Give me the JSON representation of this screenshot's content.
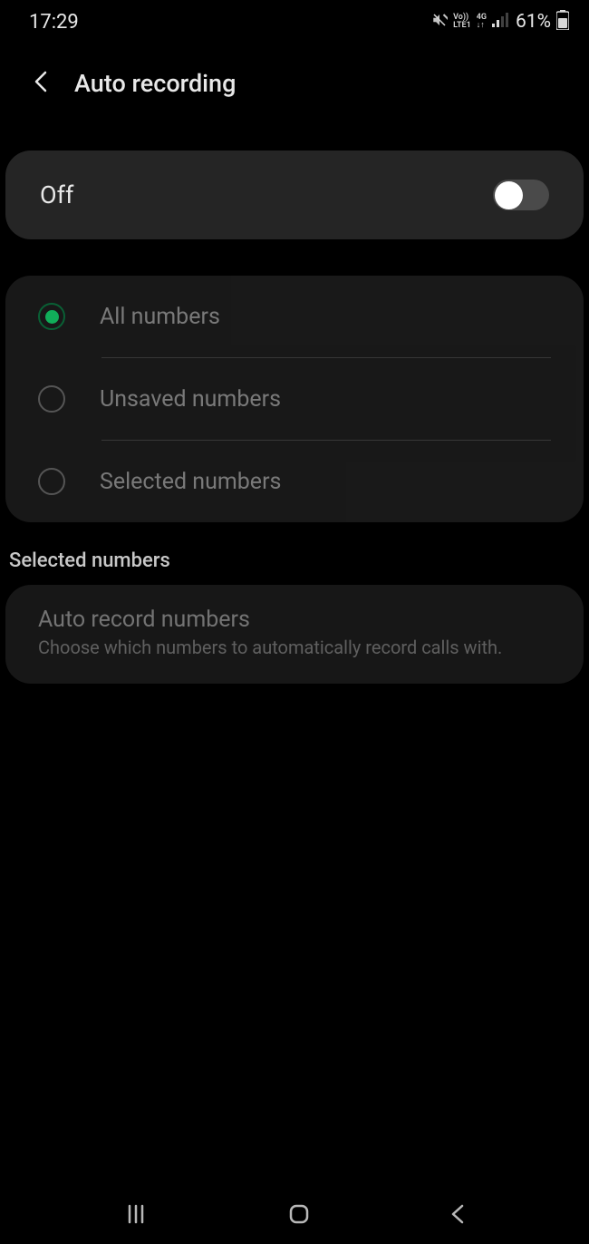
{
  "status": {
    "time": "17:29",
    "battery": "61%"
  },
  "header": {
    "title": "Auto recording"
  },
  "toggle": {
    "label": "Off",
    "state": false
  },
  "radio_options": [
    {
      "label": "All numbers",
      "selected": true
    },
    {
      "label": "Unsaved numbers",
      "selected": false
    },
    {
      "label": "Selected numbers",
      "selected": false
    }
  ],
  "section": {
    "header": "Selected numbers"
  },
  "auto_record": {
    "title": "Auto record numbers",
    "subtitle": "Choose which numbers to automatically record calls with."
  }
}
